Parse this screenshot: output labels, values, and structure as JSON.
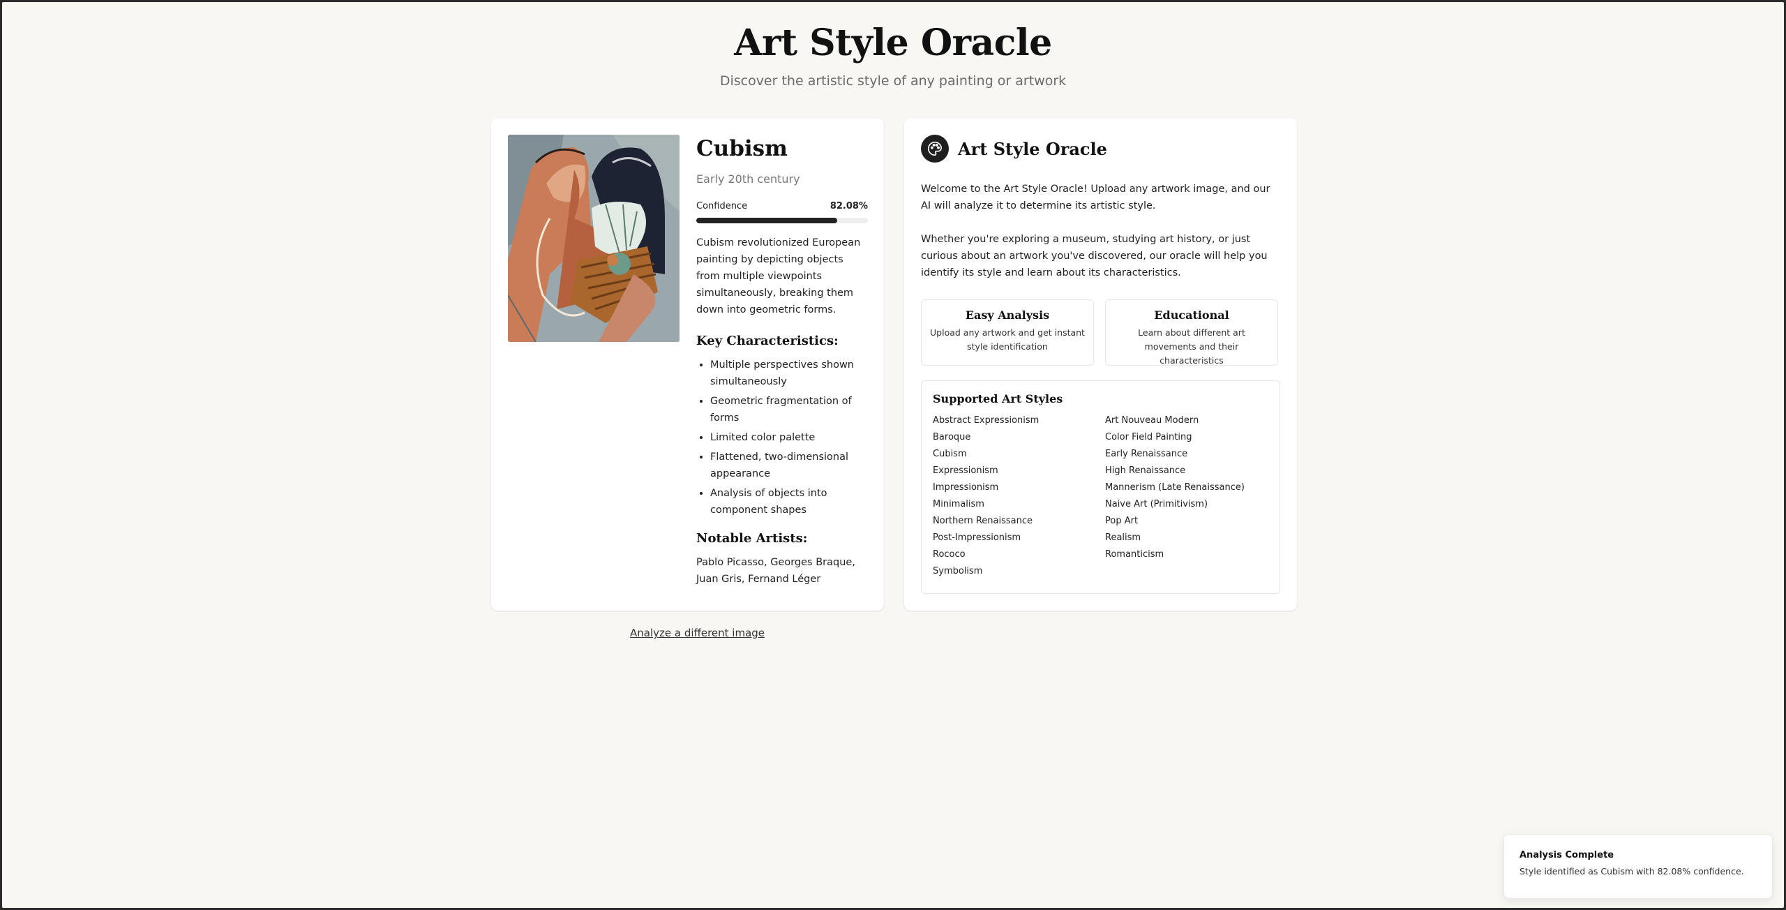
{
  "header": {
    "title": "Art Style Oracle",
    "subtitle": "Discover the artistic style of any painting or artwork"
  },
  "result": {
    "style_name": "Cubism",
    "period": "Early 20th century",
    "confidence_label": "Confidence",
    "confidence_text": "82.08%",
    "confidence_value": 82.08,
    "description": "Cubism revolutionized European painting by depicting objects from multiple viewpoints simultaneously, breaking them down into geometric forms.",
    "characteristics_heading": "Key Characteristics:",
    "characteristics": [
      "Multiple perspectives shown simultaneously",
      "Geometric fragmentation of forms",
      "Limited color palette",
      "Flattened, two-dimensional appearance",
      "Analysis of objects into component shapes"
    ],
    "artists_heading": "Notable Artists:",
    "artists": "Pablo Picasso, Georges Braque, Juan Gris, Fernand Léger"
  },
  "analyze_link": "Analyze a different image",
  "info": {
    "title": "Art Style Oracle",
    "icon": "palette-icon",
    "intro_1": "Welcome to the Art Style Oracle! Upload any artwork image, and our AI will analyze it to determine its artistic style.",
    "intro_2": "Whether you're exploring a museum, studying art history, or just curious about an artwork you've discovered, our oracle will help you identify its style and learn about its characteristics.",
    "features": [
      {
        "title": "Easy Analysis",
        "desc": "Upload any artwork and get instant style identification"
      },
      {
        "title": "Educational",
        "desc": "Learn about different art movements and their characteristics"
      }
    ],
    "styles_title": "Supported Art Styles",
    "styles": [
      "Abstract Expressionism",
      "Art Nouveau Modern",
      "Baroque",
      "Color Field Painting",
      "Cubism",
      "Early Renaissance",
      "Expressionism",
      "High Renaissance",
      "Impressionism",
      "Mannerism (Late Renaissance)",
      "Minimalism",
      "Naive Art (Primitivism)",
      "Northern Renaissance",
      "Pop Art",
      "Post-Impressionism",
      "Realism",
      "Rococo",
      "Romanticism",
      "Symbolism"
    ]
  },
  "toast": {
    "title": "Analysis Complete",
    "message": "Style identified as Cubism with 82.08% confidence."
  },
  "colors": {
    "background": "#f8f7f4",
    "card": "#ffffff",
    "accent": "#222222"
  }
}
